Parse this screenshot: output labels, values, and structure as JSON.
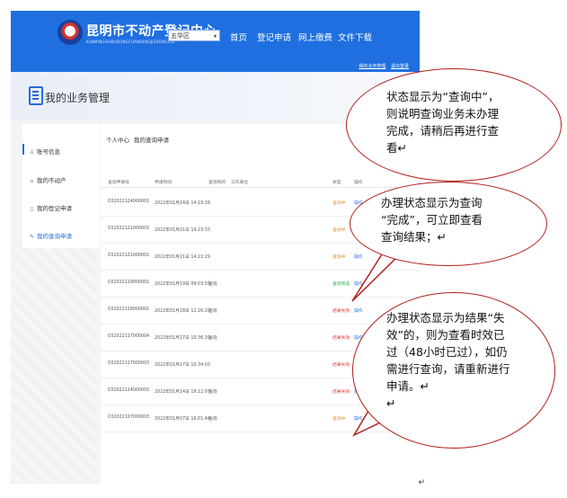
{
  "header": {
    "org_name": "昆明市不动产登记中心",
    "org_sub": "KUNMINGSHIBUDONGCHANDENGJIZHONGXIN",
    "district": "五华区",
    "nav": [
      "首页",
      "登记申请",
      "网上缴费",
      "文件下载"
    ],
    "user_links": [
      "我的业务管理",
      "退出登录"
    ]
  },
  "page": {
    "title": "我的业务管理"
  },
  "sidebar": {
    "items": [
      {
        "label": "账号信息",
        "icon": "user-icon",
        "ic": "♙"
      },
      {
        "label": "我的不动产",
        "icon": "house-icon",
        "ic": "⌂"
      },
      {
        "label": "我的登记申请",
        "icon": "document-icon",
        "ic": "▯"
      },
      {
        "label": "我的查询申请",
        "icon": "edit-icon",
        "ic": "✎"
      }
    ]
  },
  "breadcrumb": [
    "个人中心",
    "我的查询申请"
  ],
  "table": {
    "headers": [
      "查询申请号",
      "申请时间",
      "查询目的",
      "工作单位",
      "状态",
      "操作"
    ],
    "rows": [
      {
        "id": "C02022124000001",
        "time": "2022年01月24日 14:19:28",
        "purpose": "",
        "status": "查询中",
        "st": "q",
        "op": "操作"
      },
      {
        "id": "C02022121000003",
        "time": "2022年01月21日 14:23:33",
        "purpose": "",
        "status": "查询中",
        "st": "q",
        "op": "操作"
      },
      {
        "id": "C02022121000002",
        "time": "2022年01月21日 14:22:29",
        "purpose": "",
        "status": "查询中",
        "st": "q",
        "op": "操作"
      },
      {
        "id": "C02022119000001",
        "time": "2022年01月19日 09:03:59",
        "purpose": "查询",
        "status": "查询完成",
        "st": "d",
        "op": "操作"
      },
      {
        "id": "C02022118000001",
        "time": "2022年01月18日 12:26:20",
        "purpose": "查询",
        "status": "结果失效",
        "st": "x",
        "op": "操作"
      },
      {
        "id": "C02022117000004",
        "time": "2022年01月17日 10:36:39",
        "purpose": "查询",
        "status": "结果失效",
        "st": "x",
        "op": "操作"
      },
      {
        "id": "C02022117000003",
        "time": "2022年01月17日 10:34:03",
        "purpose": "",
        "status": "结果失效",
        "st": "x",
        "op": "操作"
      },
      {
        "id": "C02022114000003",
        "time": "2022年01月14日 19:12:07",
        "purpose": "查询",
        "status": "结果失效",
        "st": "x",
        "op": "操作"
      },
      {
        "id": "C02022107000003",
        "time": "2022年01月07日 16:01:44",
        "purpose": "查询",
        "status": "查询中",
        "st": "q",
        "op": "操作"
      }
    ]
  },
  "callouts": [
    {
      "lines": [
        "状态显示为“查询中”，",
        "则说明查询业务未办理",
        "完成，请稍后再进行查",
        "看↵"
      ]
    },
    {
      "lines": [
        "办理状态显示为查询",
        "“完成”，可立即查看",
        "查询结果；↵"
      ]
    },
    {
      "lines": [
        "办理状态显示为结果“失",
        "效”的，则为查看时效已",
        "过（48小时已过），如仍",
        "需进行查询，请重新进行",
        "申请。↵",
        "↵"
      ]
    }
  ],
  "end_mark": "↵",
  "colors": {
    "brand": "#1f6fe0",
    "callout_border": "#b0201b",
    "status_querying": "#e08a2e",
    "status_done": "#2aa84a",
    "status_expired": "#e03b3b"
  }
}
